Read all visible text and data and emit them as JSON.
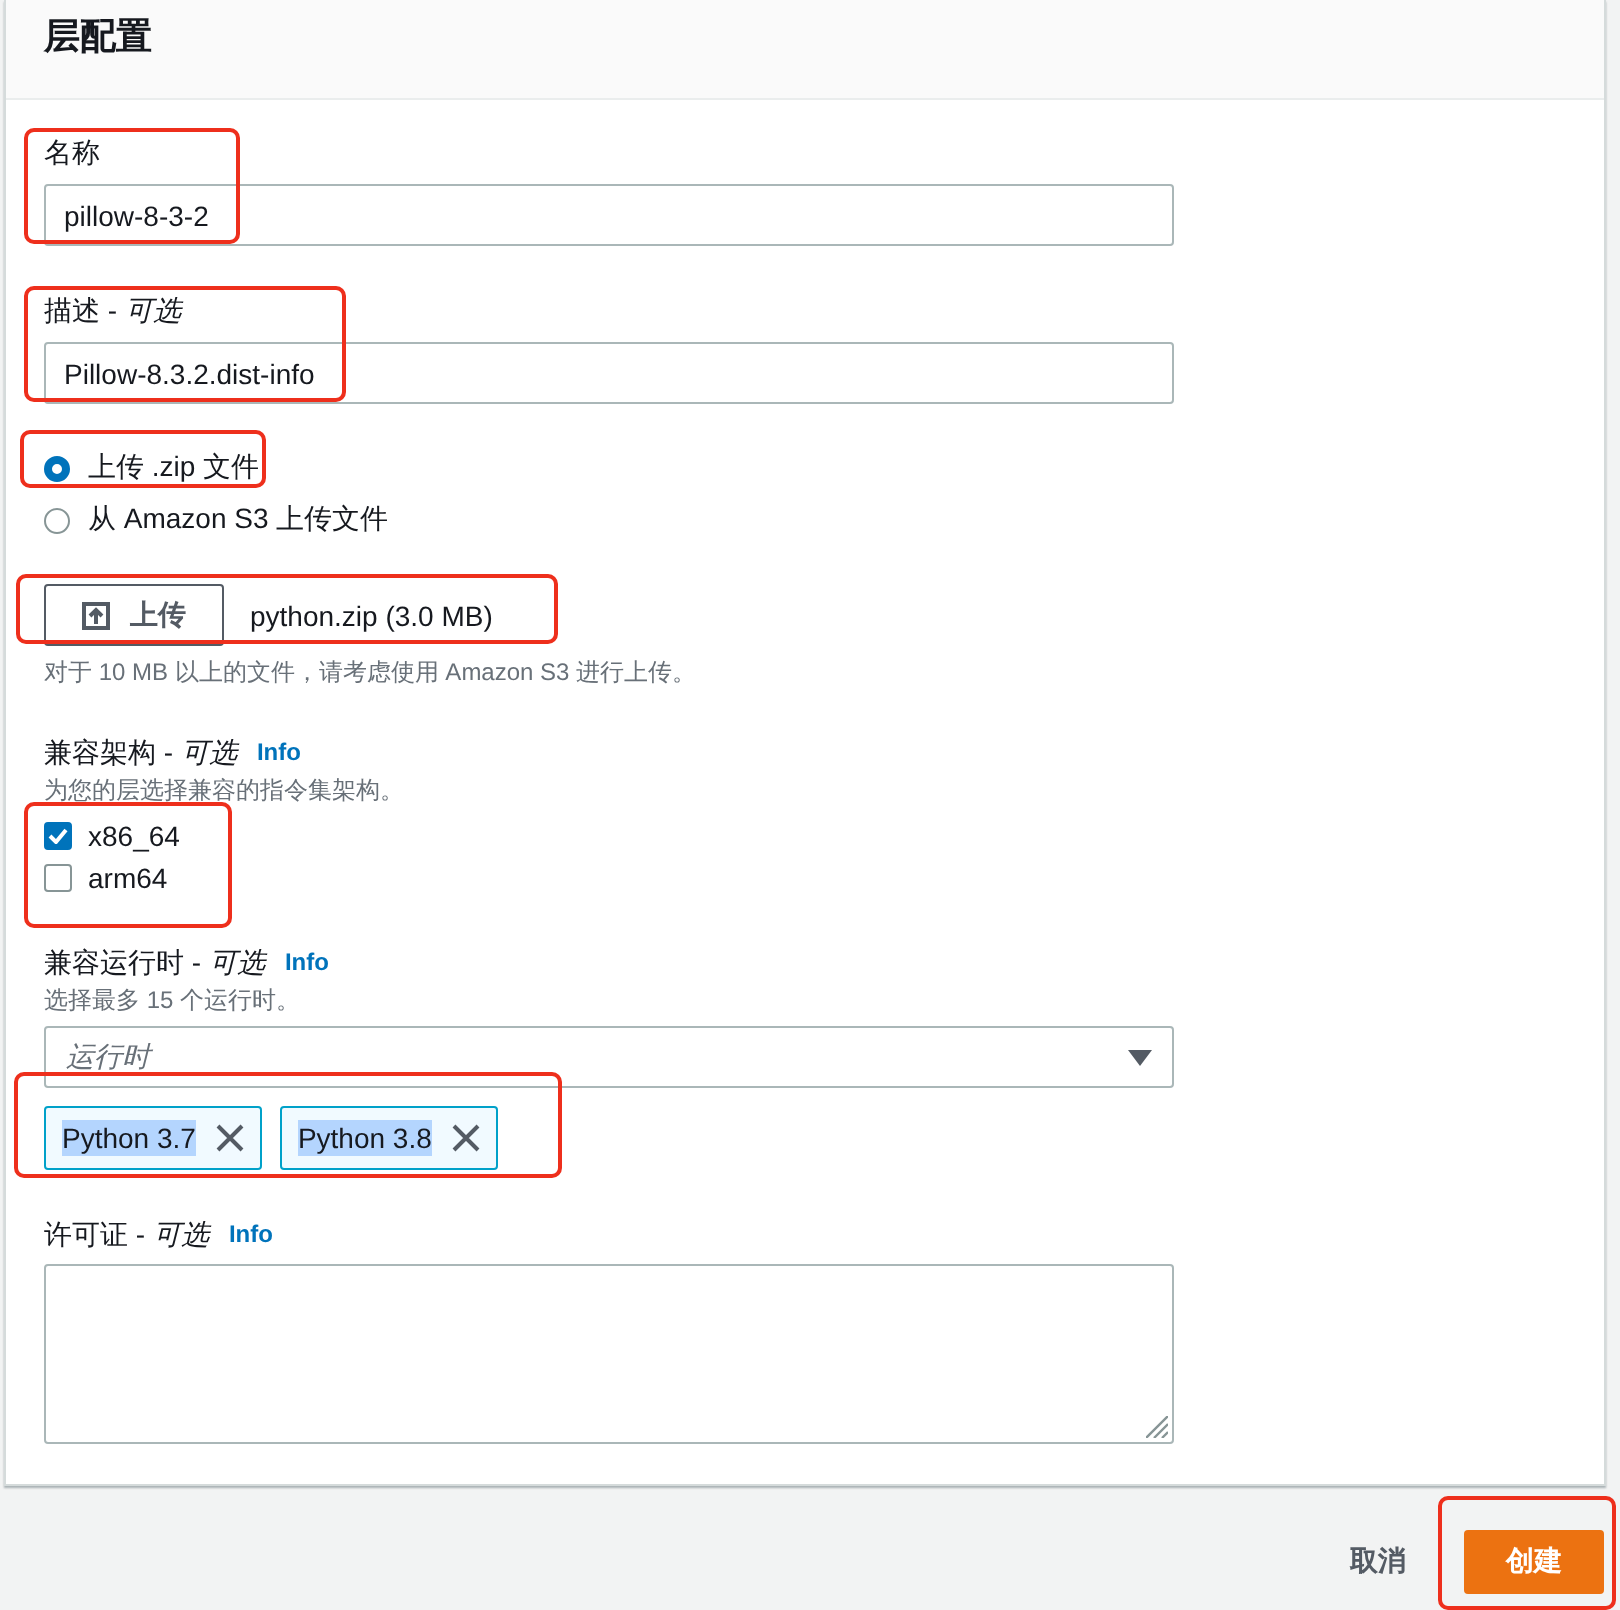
{
  "panel": {
    "title": "层配置"
  },
  "sections": [
    {
      "kind": "text",
      "label": "名称",
      "value": "pillow-8-3-2",
      "highlighted": true
    },
    {
      "kind": "text",
      "label": "描述 - *可选*",
      "value": "Pillow-8.3.2.dist-info",
      "highlighted": true
    },
    {
      "kind": "radio",
      "options": [
        {
          "label": "上传 .zip 文件",
          "selected": true,
          "highlighted": true
        },
        {
          "label": "从 Amazon S3 上传文件",
          "selected": false,
          "highlighted": false
        }
      ]
    },
    {
      "kind": "upload",
      "button": "上传",
      "file": "python.zip (3.0 MB)",
      "hint": "对于 10 MB 以上的文件，请考虑使用 Amazon S3 进行上传。",
      "highlighted": true
    },
    {
      "kind": "checkbox",
      "label": "兼容架构 - *可选*",
      "info": "Info",
      "description": "为您的层选择兼容的指令集架构。",
      "options": [
        {
          "label": "x86_64",
          "checked": true
        },
        {
          "label": "arm64",
          "checked": false
        }
      ],
      "highlighted": true
    },
    {
      "kind": "multiselect",
      "label": "兼容运行时 - *可选*",
      "info": "Info",
      "description": "选择最多 15 个运行时。",
      "placeholder": "运行时",
      "tokens": [
        {
          "label": "Python 3.7"
        },
        {
          "label": "Python 3.8"
        }
      ],
      "highlighted": true
    },
    {
      "kind": "textarea",
      "label": "许可证 - *可选*",
      "info": "Info"
    }
  ],
  "footer": {
    "buttons": [
      {
        "kind": "link",
        "label": "取消",
        "highlighted": false
      },
      {
        "kind": "primary",
        "label": "创建",
        "highlighted": true
      }
    ]
  }
}
